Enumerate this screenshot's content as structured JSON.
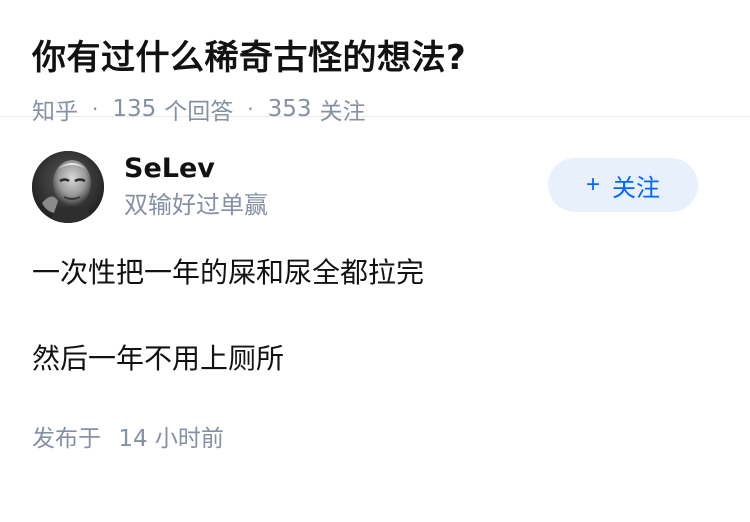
{
  "question": {
    "title": "你有过什么稀奇古怪的想法?",
    "source": "知乎",
    "answer_count": "135",
    "answer_label": "个回答",
    "follower_count": "353",
    "follower_label": "关注",
    "separator": "·"
  },
  "answer": {
    "author": {
      "name": "SeLev",
      "bio": "双输好过单赢",
      "avatar": "avatar-portrait"
    },
    "follow_button": {
      "plus": "+",
      "label": "关注"
    },
    "paragraphs": [
      "一次性把一年的屎和尿全都拉完",
      "然后一年不用上厕所"
    ],
    "published_prefix": "发布于",
    "published_time": "14 小时前"
  },
  "colors": {
    "title": "#121212",
    "meta": "#8590a6",
    "accent": "#0066ff",
    "follow_bg": "#e8f1fb"
  }
}
